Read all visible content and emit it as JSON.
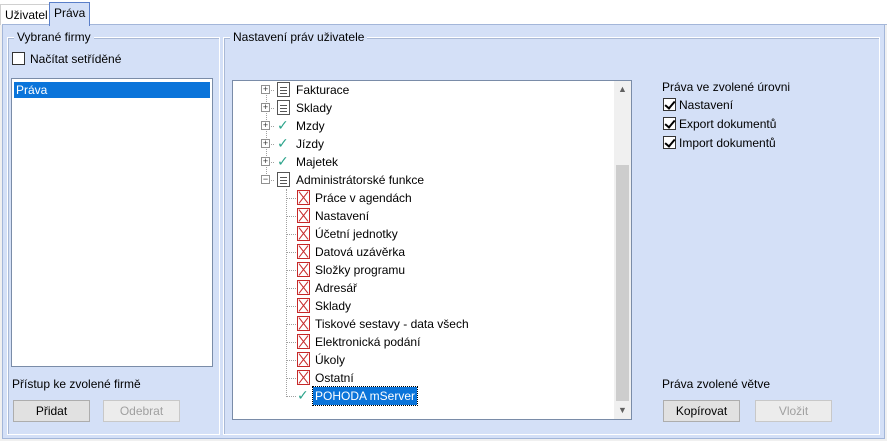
{
  "tabs": [
    {
      "label": "Uživatel",
      "active": false
    },
    {
      "label": "Práva",
      "active": true
    }
  ],
  "left_group": {
    "title": "Vybrané firmy",
    "sort_checkbox_label": "Načítat setříděné",
    "sort_checked": false,
    "list_items": [
      "Práva"
    ],
    "access_label": "Přístup ke zvolené firmě",
    "add_button": "Přidat",
    "remove_button": "Odebrat"
  },
  "right_group": {
    "title": "Nastavení práv uživatele",
    "tree": [
      {
        "label": "Fakturace",
        "icon": "document-icon",
        "expander": "+"
      },
      {
        "label": "Sklady",
        "icon": "document-icon",
        "expander": "+"
      },
      {
        "label": "Mzdy",
        "icon": "checkmark-icon",
        "expander": "+"
      },
      {
        "label": "Jízdy",
        "icon": "checkmark-icon",
        "expander": "+"
      },
      {
        "label": "Majetek",
        "icon": "checkmark-icon",
        "expander": "+"
      },
      {
        "label": "Administrátorské funkce",
        "icon": "document-icon",
        "expander": "-"
      }
    ],
    "admin_children": [
      {
        "label": "Práce v agendách",
        "icon": "denied-icon"
      },
      {
        "label": "Nastavení",
        "icon": "denied-icon"
      },
      {
        "label": "Účetní jednotky",
        "icon": "denied-icon"
      },
      {
        "label": "Datová uzávěrka",
        "icon": "denied-icon"
      },
      {
        "label": "Složky programu",
        "icon": "denied-icon"
      },
      {
        "label": "Adresář",
        "icon": "denied-icon"
      },
      {
        "label": "Sklady",
        "icon": "denied-icon"
      },
      {
        "label": "Tiskové sestavy - data všech",
        "icon": "denied-icon"
      },
      {
        "label": "Elektronická podání",
        "icon": "denied-icon"
      },
      {
        "label": "Úkoly",
        "icon": "denied-icon"
      },
      {
        "label": "Ostatní",
        "icon": "denied-icon"
      },
      {
        "label": "POHODA mServer",
        "icon": "checkmark-icon",
        "selected": true
      }
    ],
    "level_rights": {
      "title": "Práva ve zvolené úrovni",
      "options": [
        {
          "label": "Nastavení",
          "checked": true
        },
        {
          "label": "Export dokumentů",
          "checked": true
        },
        {
          "label": "Import dokumentů",
          "checked": true
        }
      ]
    },
    "branch_rights": {
      "title": "Práva zvolené větve",
      "copy_button": "Kopírovat",
      "paste_button": "Vložit"
    }
  },
  "colors": {
    "panel_bg": "#d4e0f7",
    "selection": "#0a74da",
    "check_green": "#2aa38a",
    "denied_red": "#c62828"
  }
}
